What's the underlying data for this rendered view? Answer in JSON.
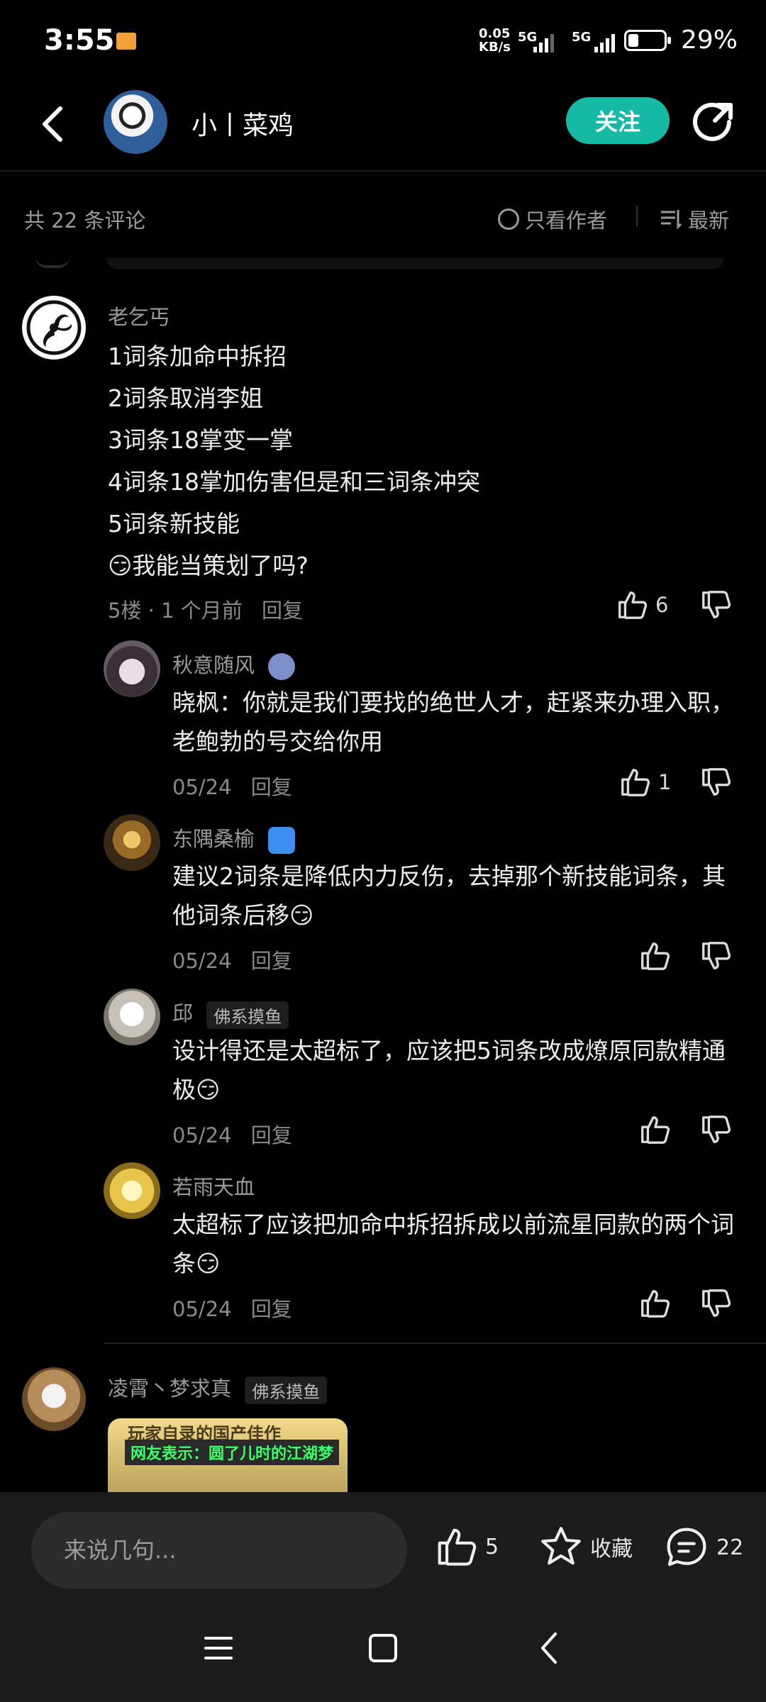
{
  "status_bar": {
    "time": "3:55",
    "net_speed_value": "0.05",
    "net_speed_unit": "KB/s",
    "sim1": "5G",
    "sim2": "5G",
    "battery_percent": "29%",
    "battery_level": 0.29
  },
  "header": {
    "author_name": "小丨菜鸡",
    "follow_label": "关注"
  },
  "subbar": {
    "comment_count": "共 22 条评论",
    "author_only_label": "只看作者",
    "sort_label": "最新"
  },
  "comments": [
    {
      "user": "老乞丐",
      "lines": [
        "1词条加命中拆招",
        "2词条取消李姐",
        "3词条18掌变一掌",
        "4词条18掌加伤害但是和三词条冲突",
        "5词条新技能",
        "😏我能当策划了吗?"
      ],
      "meta": "5楼 · 1 个月前",
      "reply_label": "回复",
      "likes": "6",
      "replies": [
        {
          "user": "秋意随风",
          "text": "晓枫：你就是我们要找的绝世人才，赶紧来办理入职，老鲍勃的号交给你用",
          "date": "05/24",
          "reply_label": "回复",
          "likes": "1"
        },
        {
          "user": "东隅桑榆",
          "text": "建议2词条是降低内力反伤，去掉那个新技能词条，其他词条后移😏",
          "date": "05/24",
          "reply_label": "回复",
          "likes": ""
        },
        {
          "user": "邱",
          "tag": "佛系摸鱼",
          "text": "设计得还是太超标了，应该把5词条改成燎原同款精通极😏",
          "date": "05/24",
          "reply_label": "回复",
          "likes": ""
        },
        {
          "user": "若雨天血",
          "text": "太超标了应该把加命中拆招拆成以前流星同款的两个词条😏",
          "date": "05/24",
          "reply_label": "回复",
          "likes": ""
        }
      ]
    },
    {
      "user": "凌霄丶梦求真",
      "tag": "佛系摸鱼",
      "image_text_1": "玩家自录的国产佳作",
      "image_text_2": "网友表示：圆了儿时的江湖梦"
    }
  ],
  "bottom_bar": {
    "input_placeholder": "来说几句...",
    "like_count": "5",
    "collect_label": "收藏",
    "comment_count": "22"
  },
  "colors": {
    "accent": "#16b9a4",
    "background": "#000000"
  }
}
